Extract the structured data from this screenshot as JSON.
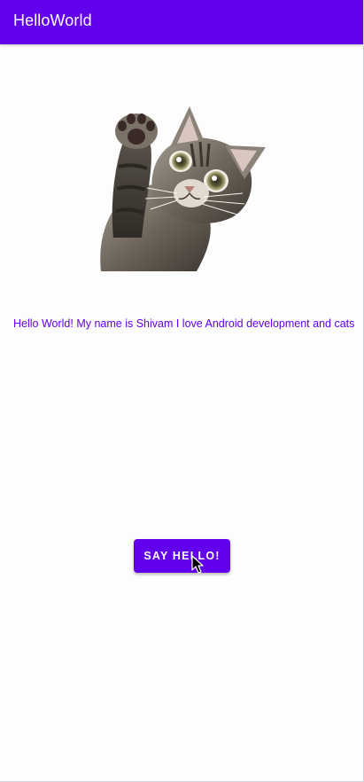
{
  "app_bar": {
    "title": "HelloWorld",
    "background_color": "#6200ee"
  },
  "main": {
    "image": "cat-photo",
    "greeting_text": "Hello World! My name is Shivam I love Android development and cats",
    "greeting_color": "#6200ee",
    "button_label": "SAY HELLO!",
    "button_color": "#6200ee"
  },
  "cursor": "mouse-pointer-icon"
}
